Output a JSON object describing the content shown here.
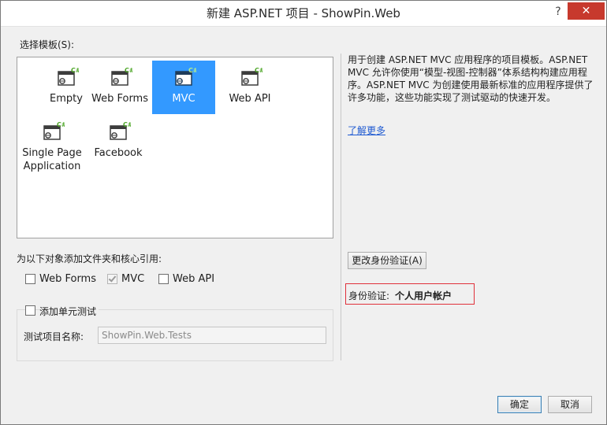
{
  "window": {
    "title": "新建 ASP.NET 项目 - ShowPin.Web",
    "help_label": "?",
    "close_label": "✕"
  },
  "templates": {
    "heading": "选择模板(S):",
    "items": [
      {
        "label": "Empty",
        "icon": "web-project-template-icon",
        "selected": false
      },
      {
        "label": "Web Forms",
        "icon": "web-project-template-icon",
        "selected": false
      },
      {
        "label": "MVC",
        "icon": "web-project-template-icon",
        "selected": true
      },
      {
        "label": "Web API",
        "icon": "web-project-template-icon",
        "selected": false
      },
      {
        "label": "Single Page\nApplication",
        "icon": "web-project-template-icon",
        "selected": false
      },
      {
        "label": "Facebook",
        "icon": "web-project-template-icon",
        "selected": false
      }
    ]
  },
  "description": {
    "text": "用于创建 ASP.NET MVC 应用程序的项目模板。ASP.NET MVC 允许你使用“模型-视图-控制器”体系结构构建应用程序。ASP.NET MVC 为创建使用最新标准的应用程序提供了许多功能，这些功能实现了测试驱动的快速开发。",
    "learn_more": "了解更多"
  },
  "folders": {
    "heading": "为以下对象添加文件夹和核心引用:",
    "options": [
      {
        "label": "Web Forms",
        "checked": false
      },
      {
        "label": "MVC",
        "checked": true
      },
      {
        "label": "Web API",
        "checked": false
      }
    ]
  },
  "unit_test": {
    "checkbox_label": "添加单元测试",
    "checked": false,
    "project_name_label": "测试项目名称:",
    "project_name_value": "ShowPin.Web.Tests"
  },
  "auth": {
    "change_button": "更改身份验证(A)",
    "label": "身份验证:",
    "value": "个人用户帐户"
  },
  "footer": {
    "ok": "确定",
    "cancel": "取消"
  },
  "colors": {
    "selection": "#3399ff",
    "close_button": "#c7392d",
    "link": "#1f5ad1",
    "highlight_border": "#e0303a"
  }
}
